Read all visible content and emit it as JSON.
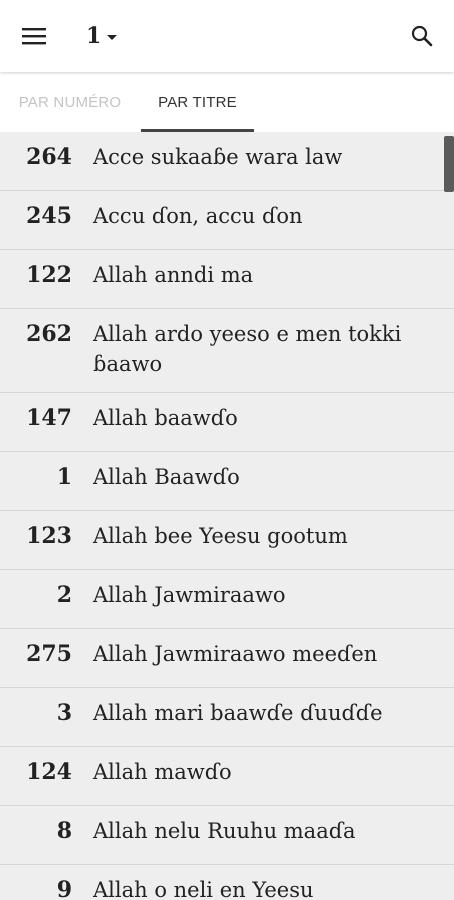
{
  "appbar": {
    "hymnal_value": "1"
  },
  "tabs": {
    "by_number": "PAR NUMÉRO",
    "by_title": "PAR TITRE",
    "active": "by_title"
  },
  "songs": [
    {
      "number": "264",
      "title": "Acce sukaaɓe wara law"
    },
    {
      "number": "245",
      "title": "Accu ɗon, accu ɗon"
    },
    {
      "number": "122",
      "title": "Allah anndi ma"
    },
    {
      "number": "262",
      "title": "Allah ardo yeeso e men tokki ɓaawo"
    },
    {
      "number": "147",
      "title": "Allah baawɗo"
    },
    {
      "number": "1",
      "title": "Allah Baawɗo"
    },
    {
      "number": "123",
      "title": "Allah bee Yeesu gootum"
    },
    {
      "number": "2",
      "title": "Allah Jawmiraawo"
    },
    {
      "number": "275",
      "title": "Allah Jawmiraawo meeɗen"
    },
    {
      "number": "3",
      "title": "Allah mari baawɗe ɗuuɗɗe"
    },
    {
      "number": "124",
      "title": "Allah mawɗo"
    },
    {
      "number": "8",
      "title": "Allah nelu Ruuhu maaɗa"
    },
    {
      "number": "9",
      "title": "Allah o neli en Yeesu"
    }
  ],
  "colors": {
    "appbar_bg": "#ffffff",
    "list_bg": "#eeeeee",
    "text": "#222222",
    "tab_inactive": "#c4c4c4",
    "tab_indicator": "#444444",
    "scroll_thumb": "#5a5a5a"
  },
  "icons": {
    "menu": "menu-icon",
    "dropdown": "chevron-down-icon",
    "search": "search-icon"
  }
}
